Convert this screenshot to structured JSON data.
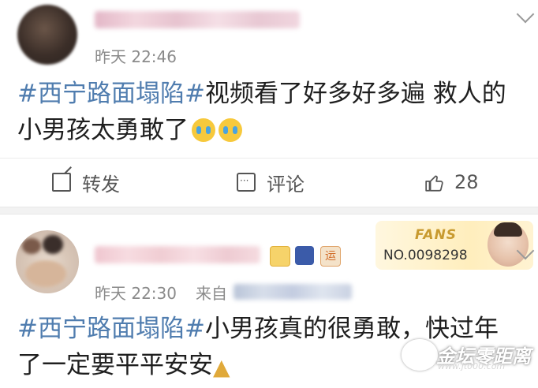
{
  "posts": [
    {
      "time": "昨天 22:46",
      "text_tag": "#西宁路面塌陷#",
      "text_body": "视频看了好多好多遍 救人的小男孩太勇敢了",
      "emoji": [
        "crying-emoji",
        "crying-emoji"
      ],
      "actions": {
        "repost_label": "转发",
        "comment_label": "评论",
        "like_count": "28"
      }
    },
    {
      "time": "昨天 22:30",
      "source_label": "来自",
      "text_tag": "#西宁路面塌陷#",
      "text_body": "小男孩真的很勇敢，快过年了一定要平平安安",
      "emoji": [
        "praying-hands-emoji"
      ],
      "badges": [
        "crown-icon",
        "star-icon",
        "运"
      ],
      "fans_card": {
        "title": "FANS",
        "number": "NO.0098298"
      }
    }
  ],
  "watermark": {
    "text": "金坛零距离",
    "url": "www.jt000.com"
  },
  "colors": {
    "hashtag": "#507daf",
    "meta": "#8a8a8a",
    "separator": "#f2f2f2"
  }
}
